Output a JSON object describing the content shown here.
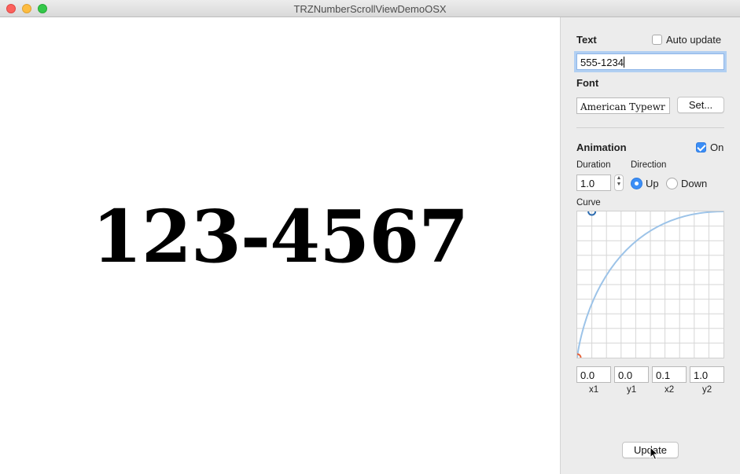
{
  "window": {
    "title": "TRZNumberScrollViewDemoOSX"
  },
  "display": {
    "number": "123-4567"
  },
  "sidebar": {
    "text_label": "Text",
    "auto_update_label": "Auto update",
    "auto_update_checked": false,
    "text_value": "555-1234",
    "font_label": "Font",
    "font_value": "American Typewr",
    "set_button": "Set...",
    "animation_label": "Animation",
    "animation_on_label": "On",
    "animation_on_checked": true,
    "duration_label": "Duration",
    "duration_value": "1.0",
    "direction_label": "Direction",
    "direction_up": "Up",
    "direction_down": "Down",
    "direction_selected": "Up",
    "curve_label": "Curve",
    "curve_points": [
      {
        "value": "0.0",
        "label": "x1"
      },
      {
        "value": "0.0",
        "label": "y1"
      },
      {
        "value": "0.1",
        "label": "x2"
      },
      {
        "value": "1.0",
        "label": "y2"
      }
    ],
    "update_button": "Update"
  },
  "colors": {
    "accent": "#3b8ef6",
    "curve_line": "#9cc3e8",
    "grid": "#d6d6d6",
    "start_handle": "#e8643c",
    "end_handle": "#2c6cb0"
  }
}
